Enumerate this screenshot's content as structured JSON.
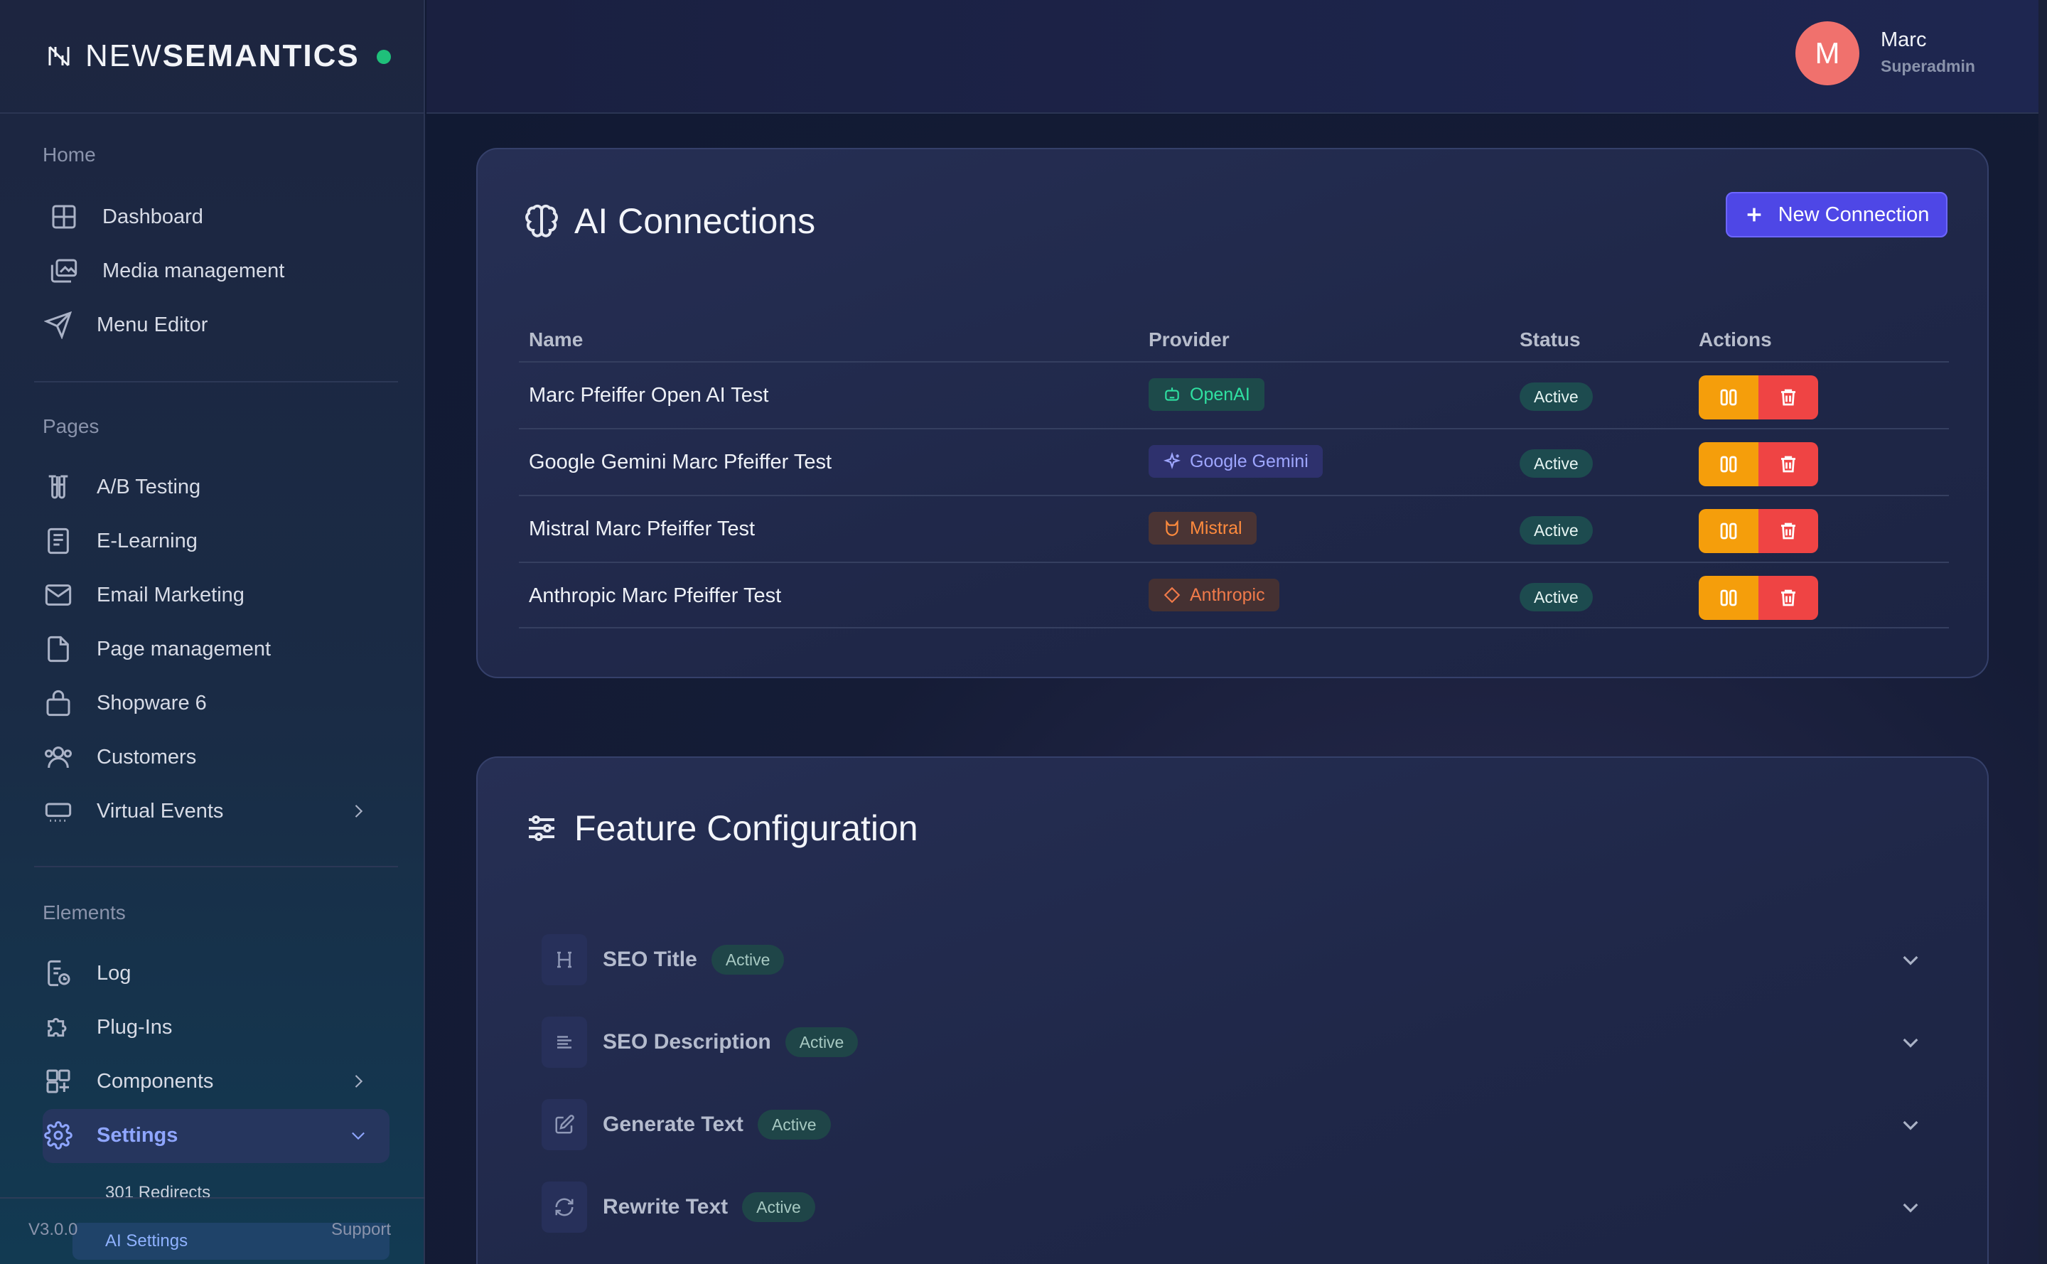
{
  "brand": {
    "prefix": "NEW",
    "name": "SEMANTICS"
  },
  "user": {
    "initial": "M",
    "name": "Marc",
    "role": "Superadmin"
  },
  "sidebar": {
    "sections": {
      "home": "Home",
      "pages": "Pages",
      "elements": "Elements"
    },
    "home_items": [
      {
        "label": "Dashboard",
        "icon": "grid-icon"
      },
      {
        "label": "Media management",
        "icon": "images-icon"
      },
      {
        "label": "Menu Editor",
        "icon": "send-icon"
      }
    ],
    "pages_items": [
      {
        "label": "A/B Testing",
        "icon": "test-tubes-icon"
      },
      {
        "label": "E-Learning",
        "icon": "book-icon"
      },
      {
        "label": "Email Marketing",
        "icon": "mail-icon"
      },
      {
        "label": "Page management",
        "icon": "file-icon"
      },
      {
        "label": "Shopware 6",
        "icon": "shopping-bag-icon"
      },
      {
        "label": "Customers",
        "icon": "users-icon"
      },
      {
        "label": "Virtual Events",
        "icon": "keyboard-icon"
      }
    ],
    "elements_items": [
      {
        "label": "Log",
        "icon": "log-icon"
      },
      {
        "label": "Plug-Ins",
        "icon": "puzzle-icon"
      },
      {
        "label": "Components",
        "icon": "components-icon"
      },
      {
        "label": "Settings",
        "icon": "gear-icon"
      }
    ],
    "settings_sub": [
      {
        "label": "301 Redirects"
      },
      {
        "label": "AI Settings"
      }
    ],
    "footer": {
      "version": "V3.0.0",
      "support": "Support"
    }
  },
  "connections": {
    "title": "AI Connections",
    "new_button": "New Connection",
    "columns": [
      "Name",
      "Provider",
      "Status",
      "Actions"
    ],
    "rows": [
      {
        "name": "Marc Pfeiffer Open AI Test",
        "provider": "OpenAI",
        "status": "Active"
      },
      {
        "name": "Google Gemini Marc Pfeiffer Test",
        "provider": "Google Gemini",
        "status": "Active"
      },
      {
        "name": "Mistral Marc Pfeiffer Test",
        "provider": "Mistral",
        "status": "Active"
      },
      {
        "name": "Anthropic Marc Pfeiffer Test",
        "provider": "Anthropic",
        "status": "Active"
      }
    ]
  },
  "features": {
    "title": "Feature Configuration",
    "items": [
      {
        "label": "SEO Title",
        "status": "Active",
        "icon": "heading-icon"
      },
      {
        "label": "SEO Description",
        "status": "Active",
        "icon": "align-left-icon"
      },
      {
        "label": "Generate Text",
        "status": "Active",
        "icon": "edit-icon"
      },
      {
        "label": "Rewrite Text",
        "status": "Active",
        "icon": "refresh-icon"
      }
    ]
  },
  "colors": {
    "accent": "#4e47e6",
    "status_dot": "#1fc07a",
    "edit": "#f59e0b",
    "delete": "#ef4444"
  }
}
